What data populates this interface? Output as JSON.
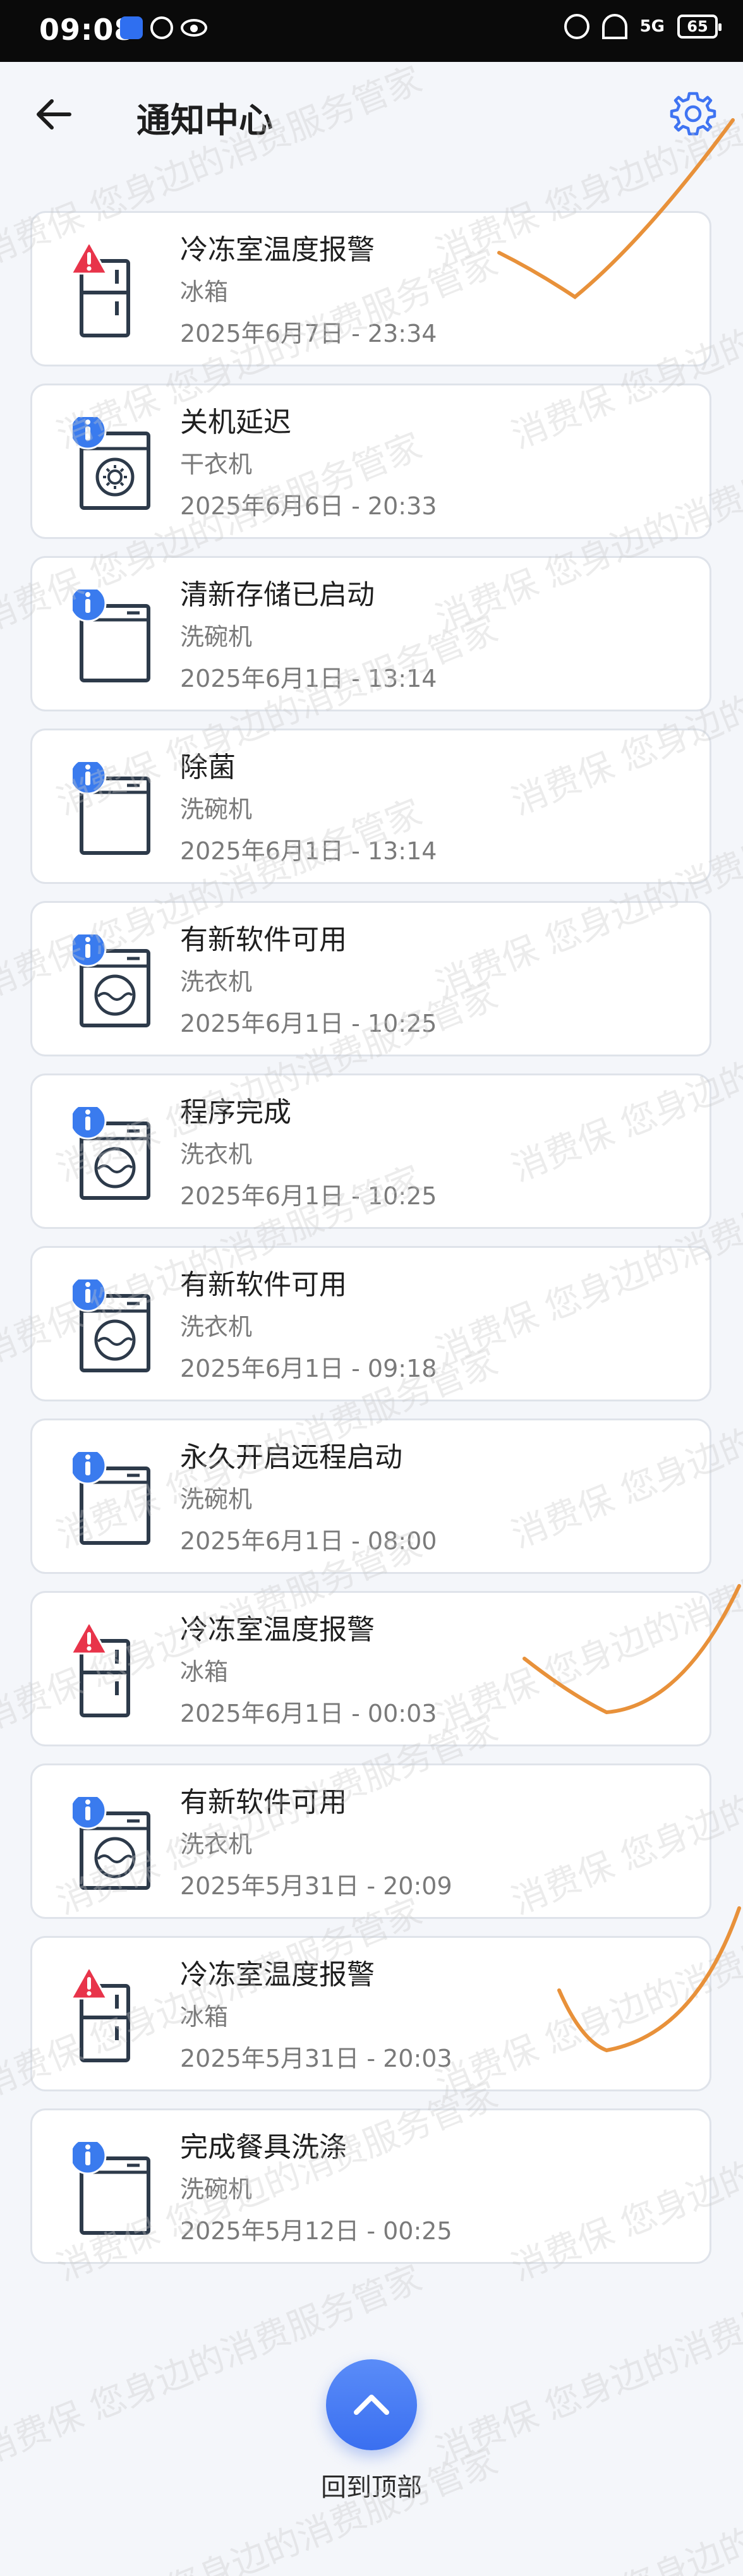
{
  "status_bar": {
    "time": "09:08",
    "network": "5G",
    "battery": "65"
  },
  "header": {
    "title": "通知中心",
    "back_icon": "arrow-left-icon",
    "settings_icon": "gear-icon"
  },
  "notifications": [
    {
      "title": "冷冻室温度报警",
      "device": "冰箱",
      "time": "2025年6月7日 - 23:34",
      "kind": "alert",
      "device_icon": "fridge"
    },
    {
      "title": "关机延迟",
      "device": "干衣机",
      "time": "2025年6月6日 - 20:33",
      "kind": "info",
      "device_icon": "dryer"
    },
    {
      "title": "清新存储已启动",
      "device": "洗碗机",
      "time": "2025年6月1日 - 13:14",
      "kind": "info",
      "device_icon": "dishwasher"
    },
    {
      "title": "除菌",
      "device": "洗碗机",
      "time": "2025年6月1日 - 13:14",
      "kind": "info",
      "device_icon": "dishwasher"
    },
    {
      "title": "有新软件可用",
      "device": "洗衣机",
      "time": "2025年6月1日 - 10:25",
      "kind": "info",
      "device_icon": "washer"
    },
    {
      "title": "程序完成",
      "device": "洗衣机",
      "time": "2025年6月1日 - 10:25",
      "kind": "info",
      "device_icon": "washer"
    },
    {
      "title": "有新软件可用",
      "device": "洗衣机",
      "time": "2025年6月1日 - 09:18",
      "kind": "info",
      "device_icon": "washer"
    },
    {
      "title": "永久开启远程启动",
      "device": "洗碗机",
      "time": "2025年6月1日 - 08:00",
      "kind": "info",
      "device_icon": "dishwasher"
    },
    {
      "title": "冷冻室温度报警",
      "device": "冰箱",
      "time": "2025年6月1日 - 00:03",
      "kind": "alert",
      "device_icon": "fridge"
    },
    {
      "title": "有新软件可用",
      "device": "洗衣机",
      "time": "2025年5月31日 - 20:09",
      "kind": "info",
      "device_icon": "washer"
    },
    {
      "title": "冷冻室温度报警",
      "device": "冰箱",
      "time": "2025年5月31日 - 20:03",
      "kind": "alert",
      "device_icon": "fridge"
    },
    {
      "title": "完成餐具洗涤",
      "device": "洗碗机",
      "time": "2025年5月12日 - 00:25",
      "kind": "info",
      "device_icon": "dishwasher"
    }
  ],
  "back_to_top": {
    "label": "回到顶部",
    "icon": "chevron-up-icon"
  },
  "watermark": {
    "text": "消费保 您身边的消费服务管家"
  },
  "colors": {
    "accent": "#3f74f2",
    "alert": "#e8344a",
    "info": "#3a7bee",
    "ink": "#e8913a"
  }
}
